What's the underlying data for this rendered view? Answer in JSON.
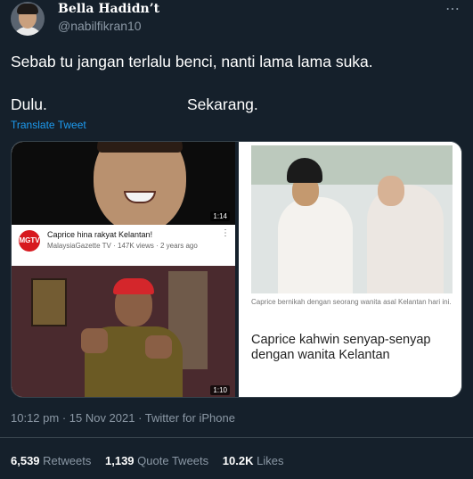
{
  "header": {
    "name": "Bella Hadidn’t",
    "handle": "@nabilfikran10",
    "more_icon": "⋯"
  },
  "tweet": {
    "line1": "Sebab tu jangan terlalu benci, nanti lama lama suka.",
    "dulu": "Dulu.",
    "sekarang": "Sekarang.",
    "translate": "Translate Tweet"
  },
  "media": {
    "left": {
      "video1_duration": "1:14",
      "channel_logo": "MGTV",
      "video_title": "Caprice hina rakyat Kelantan!",
      "video_meta": "MalaysiaGazette TV · 147K views · 2 years ago",
      "video2_duration": "1:10"
    },
    "right": {
      "caption_small": "Caprice bernikah dengan seorang wanita asal Kelantan hari ini.",
      "caption_big": "Caprice kahwin senyap-senyap dengan wanita Kelantan"
    }
  },
  "meta": {
    "time": "10:12 pm · 15 Nov 2021 · Twitter for iPhone"
  },
  "stats": {
    "retweets_count": "6,539",
    "retweets_label": "Retweets",
    "quotes_count": "1,139",
    "quotes_label": "Quote Tweets",
    "likes_count": "10.2K",
    "likes_label": "Likes"
  }
}
